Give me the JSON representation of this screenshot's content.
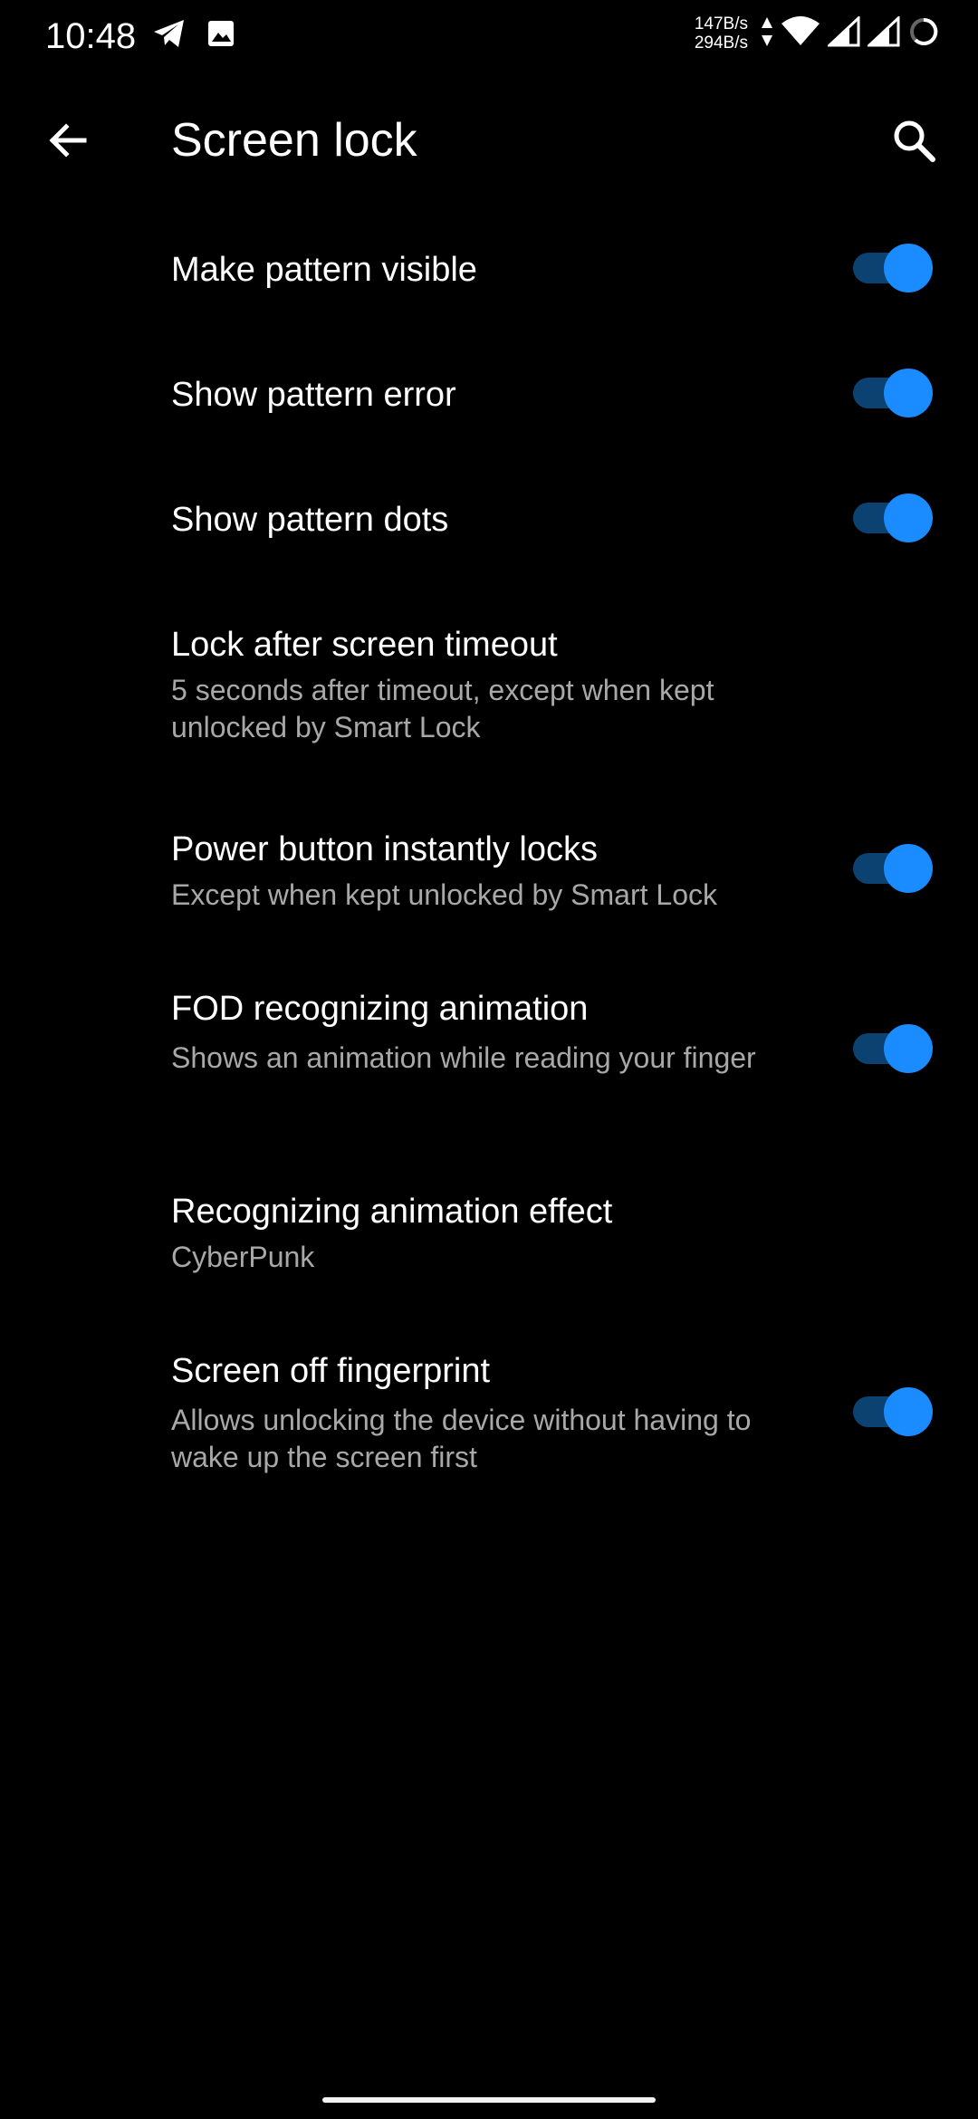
{
  "status_bar": {
    "time": "10:48",
    "net_up": "147B/s",
    "net_down": "294B/s",
    "icons": [
      "telegram-icon",
      "gallery-icon",
      "data-arrows-icon",
      "wifi-icon",
      "signal-icon",
      "signal-icon",
      "battery-icon"
    ]
  },
  "app_bar": {
    "title": "Screen lock",
    "back_icon": "arrow-left-icon",
    "search_icon": "search-icon"
  },
  "accent_color": "#1a8cff",
  "settings": [
    {
      "title": "Make pattern visible",
      "toggle": true
    },
    {
      "title": "Show pattern error",
      "toggle": true
    },
    {
      "title": "Show pattern dots",
      "toggle": true
    },
    {
      "title": "Lock after screen timeout",
      "summary": "5 seconds after timeout, except when kept unlocked by Smart Lock"
    },
    {
      "title": "Power button instantly locks",
      "summary": "Except when kept unlocked by Smart Lock",
      "toggle": true
    },
    {
      "title": "FOD recognizing animation",
      "summary": "Shows an animation while reading your finger",
      "toggle": true
    },
    {
      "title": "Recognizing animation effect",
      "summary": "CyberPunk"
    },
    {
      "title": "Screen off fingerprint",
      "summary": "Allows unlocking the device without having to wake up the screen first",
      "toggle": true
    }
  ]
}
